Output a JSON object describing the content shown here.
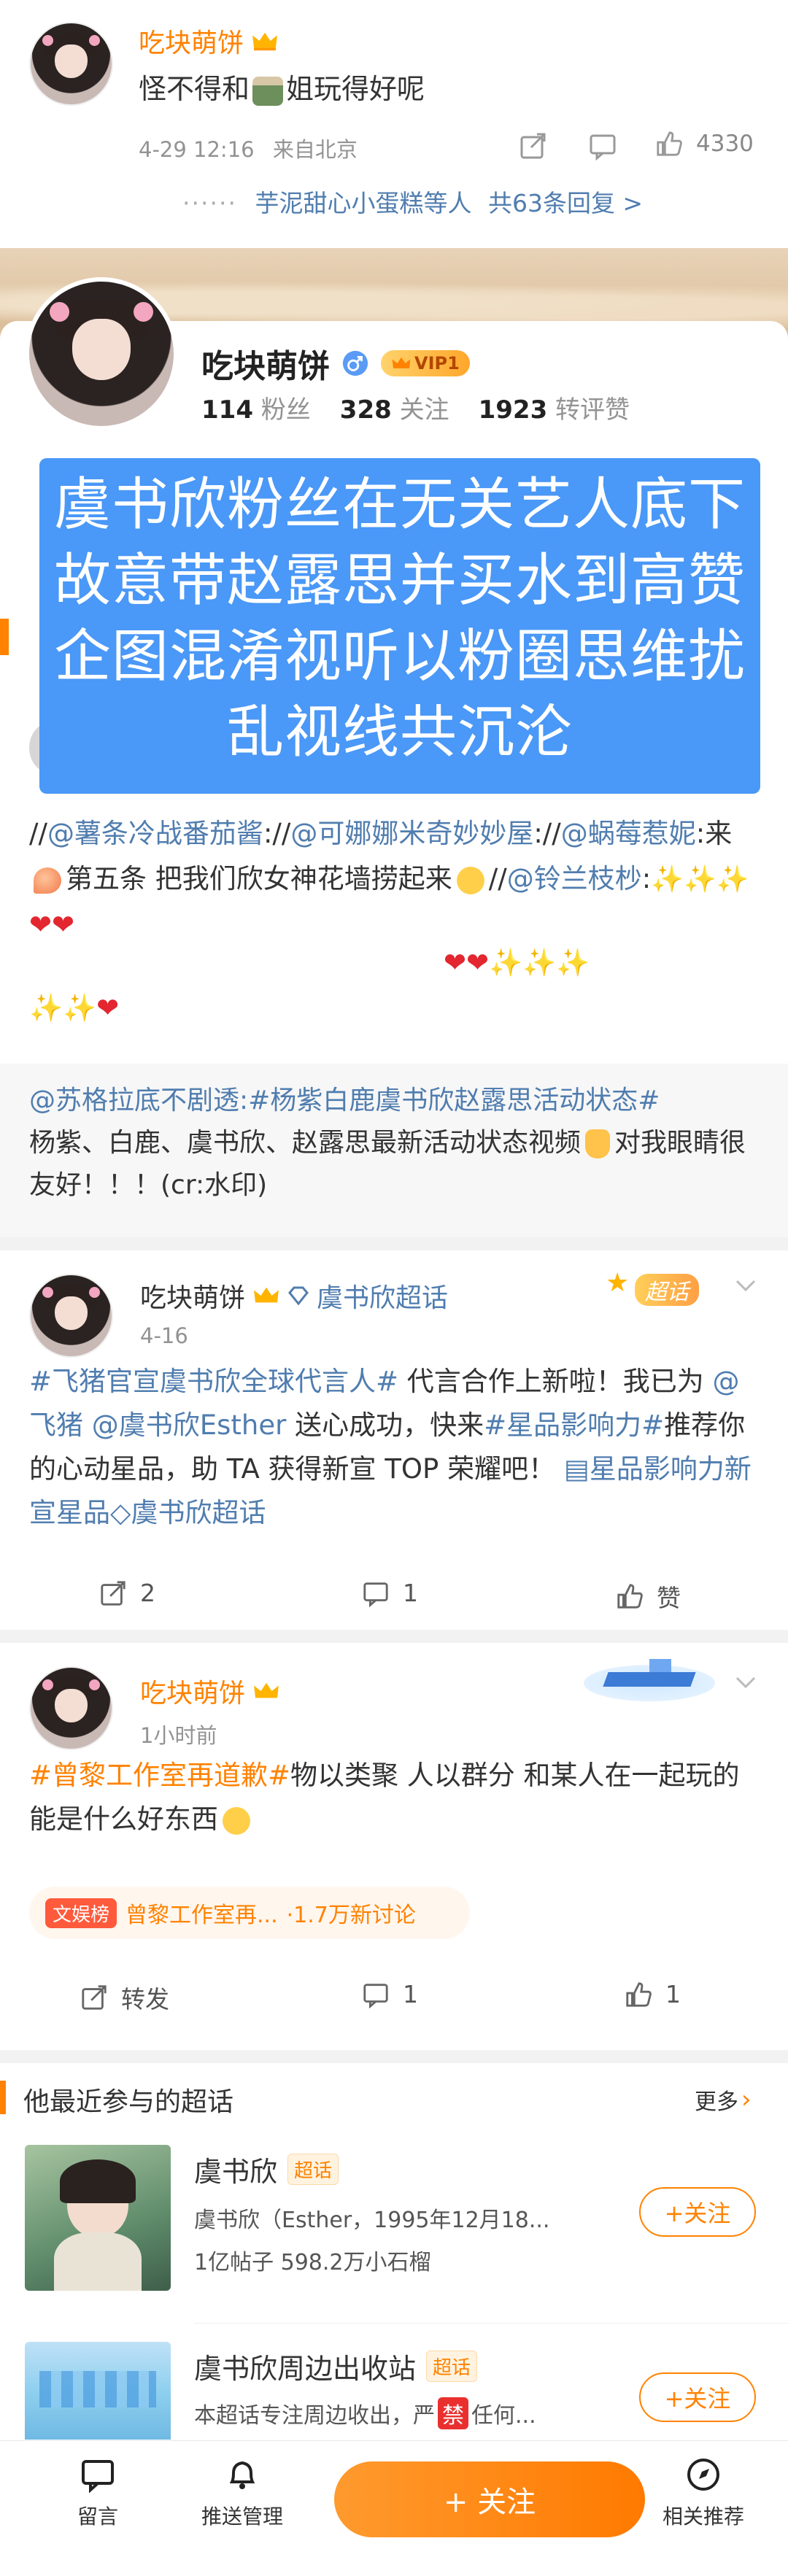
{
  "comment": {
    "username": "吃块萌饼",
    "text_before_emoji": "怪不得和",
    "text_after_emoji": "姐玩得好呢",
    "time": "4-29 12:16",
    "location": "来自北京",
    "likes": "4330",
    "replies_text": "芋泥甜心小蛋糕等人",
    "replies_count": "共63条回复 >"
  },
  "profile": {
    "username": "吃块萌饼",
    "vip_label": "VIP1",
    "fans_count": "114",
    "fans_label": "粉丝",
    "follow_count": "328",
    "follow_label": "关注",
    "repost_count": "1923",
    "repost_label": "转评赞"
  },
  "overlay_text": "虞书欣粉丝在无关艺人底下故意带赵露思并买水到高赞企图混淆视听以粉圈思维扰乱视线共沉沦",
  "post1": {
    "line1_a": "//",
    "mention1": "@薯条冷战番茄酱",
    "line1_b": "://",
    "mention2": "@可娜娜米奇妙妙屋",
    "line1_c": "://",
    "mention3": "@蜗莓惹妮",
    "line1_d": ":来",
    "line1_e": "第五条 把我们欣女神花墙捞起来",
    "line1_f": "//",
    "mention4": "@铃兰枝杪",
    "line1_g": ":"
  },
  "post2": {
    "mention": "@苏格拉底不剧透",
    "topic": ":#杨紫白鹿虞书欣赵露思活动状态#",
    "text": "杨紫、白鹿、虞书欣、赵露思最新活动状态视频",
    "text_after": "对我眼睛很友好！！！(cr:水印)"
  },
  "post3": {
    "username": "吃块萌饼",
    "supertopic": "虞书欣超话",
    "badge": "超话",
    "time": "4-16",
    "topic": "#飞猪官宣虞书欣全球代言人#",
    "text1": " 代言合作上新啦！我已为 ",
    "mention1": "@飞猪",
    "mention2": "@虞书欣Esther",
    "text2": " 送心成功，快来",
    "topic2": "#星品影响力#",
    "text3": "推荐你的心动星品，助 TA 获得新宣 TOP 荣耀吧！",
    "link1": "星品影响力新宣星品",
    "link2": "虞书欣超话",
    "reposts": "2",
    "comments": "1",
    "likes": "赞"
  },
  "post4": {
    "username": "吃块萌饼",
    "time": "1小时前",
    "topic": "#曾黎工作室再道歉#",
    "text": "物以类聚 人以群分 和某人在一起玩的能是什么好东西",
    "hot_badge": "文娱榜",
    "hot_title": "曾黎工作室再...",
    "hot_count": "·1.7万新讨论",
    "reposts": "转发",
    "comments": "1",
    "likes": "1"
  },
  "supertopics": {
    "header": "他最近参与的超话",
    "more": "更多",
    "items": [
      {
        "name": "虞书欣",
        "badge": "超话",
        "desc": "虞书欣（Esther，1995年12月18...",
        "stats": "1亿帖子 598.2万小石榴",
        "button": "+关注"
      },
      {
        "name": "虞书欣周边出收站",
        "badge": "超话",
        "desc_a": "本超话专注周边收出，严",
        "desc_b": "禁",
        "desc_c": "任何...",
        "button": "+关注"
      }
    ]
  },
  "bottombar": {
    "comment": "留言",
    "push": "推送管理",
    "follow": "+ 关注",
    "related": "相关推荐"
  },
  "colors": {
    "accent": "#ff8200",
    "link": "#507daf",
    "overlay_bg": "#4a98f7"
  }
}
